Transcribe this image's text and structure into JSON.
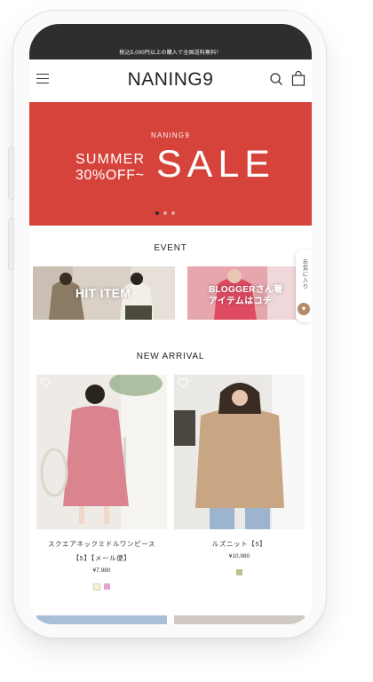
{
  "topbar": {
    "notice": "税込5,000円以上の購入で全国送料無料！"
  },
  "header": {
    "logo": "NANING9",
    "icons": [
      "menu-icon",
      "search-icon",
      "cart-icon"
    ]
  },
  "banner": {
    "brand": "NANING9",
    "line1": "SUMMER",
    "line2": "30%OFF~",
    "sale": "SALE",
    "slides": 3,
    "active_slide": 1,
    "color": "#d5433b"
  },
  "event": {
    "title": "EVENT",
    "cards": [
      {
        "label": "HIT ITEM"
      },
      {
        "label1": "BLOGGERさん着",
        "label2": "アイテムはコチ"
      }
    ]
  },
  "side_tab": {
    "label": "お気に入り",
    "icon": "heart-icon"
  },
  "new_arrival": {
    "title": "NEW ARRIVAL",
    "products": [
      {
        "name": "スクエアネックミドルワンピース",
        "name2": "【5】【メール便】",
        "price": "¥7,980",
        "swatches": [
          "#f7f2d8",
          "#e0a6d6"
        ]
      },
      {
        "name": "ルズニット【5】",
        "name2": "",
        "price": "¥10,980",
        "swatches": [
          "#bfc08c"
        ]
      }
    ]
  }
}
